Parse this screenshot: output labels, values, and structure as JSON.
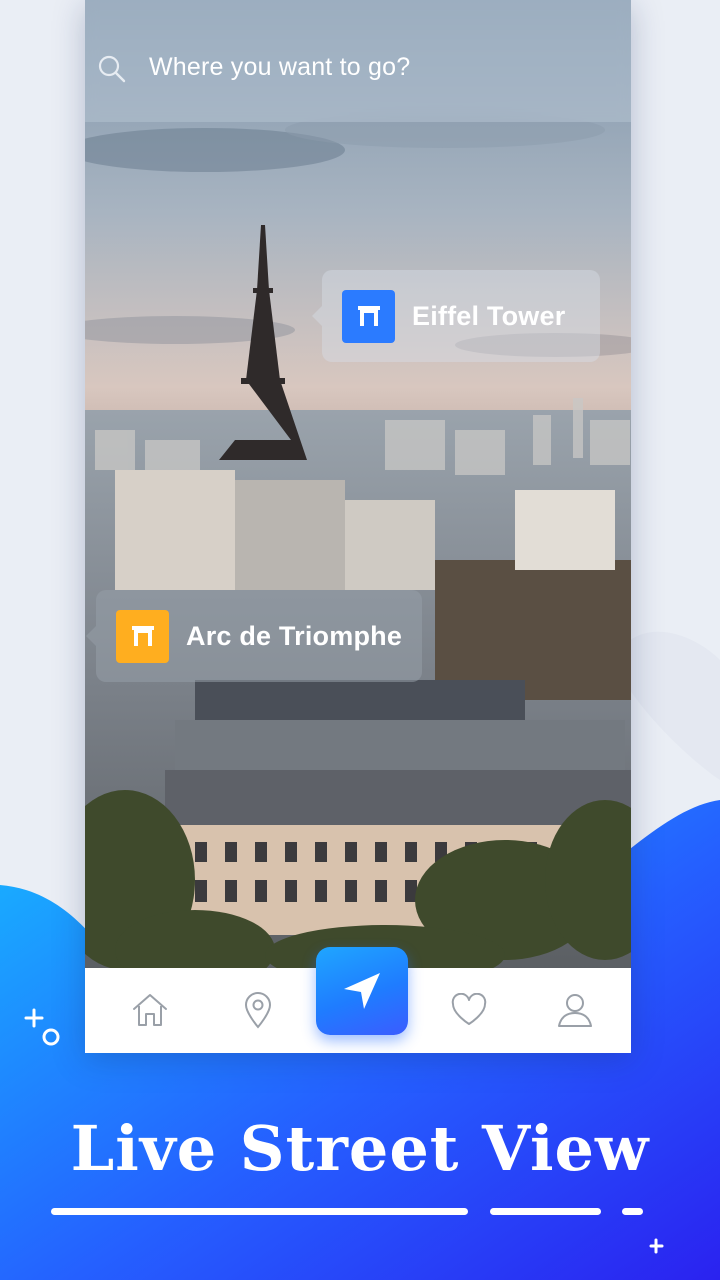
{
  "search": {
    "placeholder": "Where you want to go?",
    "icon": "search-icon"
  },
  "pois": [
    {
      "label": "Eiffel Tower",
      "color": "#2b7bff",
      "icon": "landmark-icon"
    },
    {
      "label": "Arc de Triomphe",
      "color": "#ffae1f",
      "icon": "landmark-icon"
    }
  ],
  "nav": {
    "items": [
      {
        "name": "home",
        "icon": "home-icon"
      },
      {
        "name": "location",
        "icon": "location-pin-icon"
      },
      {
        "name": "navigate",
        "icon": "navigation-arrow-icon"
      },
      {
        "name": "favorites",
        "icon": "heart-icon"
      },
      {
        "name": "profile",
        "icon": "user-icon"
      }
    ]
  },
  "promo": {
    "headline": "Live Street View"
  },
  "colors": {
    "accent": "#1f7cff",
    "promo_gradient_start": "#1aa8ff",
    "promo_gradient_end": "#2a2ef0",
    "poi_blue": "#2b7bff",
    "poi_orange": "#ffae1f"
  }
}
